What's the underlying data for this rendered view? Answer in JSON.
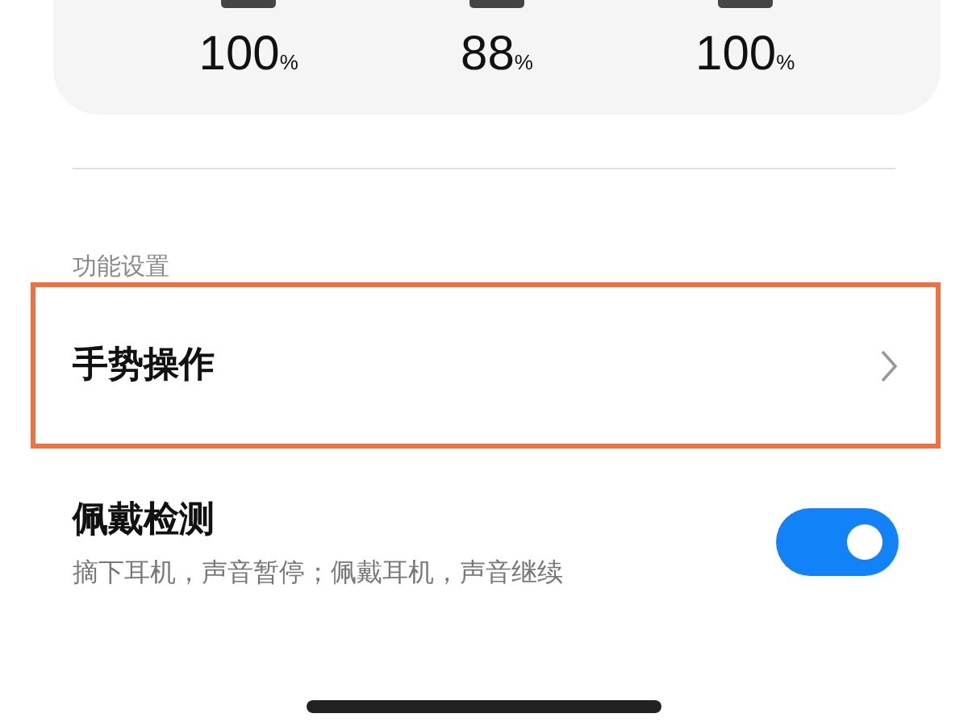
{
  "batteries": [
    {
      "value": "100",
      "unit": "%"
    },
    {
      "value": "88",
      "unit": "%"
    },
    {
      "value": "100",
      "unit": "%"
    }
  ],
  "section": {
    "title": "功能设置"
  },
  "settings": [
    {
      "kind": "link",
      "title": "手势操作",
      "highlighted": true
    },
    {
      "kind": "toggle",
      "title": "佩戴检测",
      "subtitle": "摘下耳机，声音暂停；佩戴耳机，声音继续",
      "on": true,
      "highlighted": false
    }
  ]
}
